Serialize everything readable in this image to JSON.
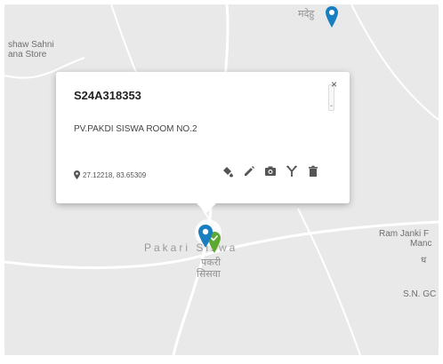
{
  "map": {
    "labels": {
      "top_left_line1": "shaw Sahni",
      "top_left_line2": "ana Store",
      "top_hindi": "मदेहु",
      "village_english": "Pakari Siswa",
      "village_hindi_line1": "पकरी",
      "village_hindi_line2": "सिसवा",
      "right_line1": "Ram Janki F",
      "right_line2": "Manc",
      "right_hindi": "ध",
      "right_bottom": "S.N. GC"
    },
    "colors": {
      "pin_blue": "#1a7fc1",
      "pin_green": "#5da831",
      "map_bg": "#e9e9ea"
    }
  },
  "popup": {
    "id": "S24A318353",
    "address": "PV.PAKDI SISWA ROOM NO.2",
    "coordinates": "27.12218, 83.65309",
    "close_symbol": "×",
    "scroll_arrow": "⌄",
    "tools": [
      "fill-color-icon",
      "edit-pencil-icon",
      "camera-icon",
      "branch-icon",
      "trash-icon"
    ]
  }
}
